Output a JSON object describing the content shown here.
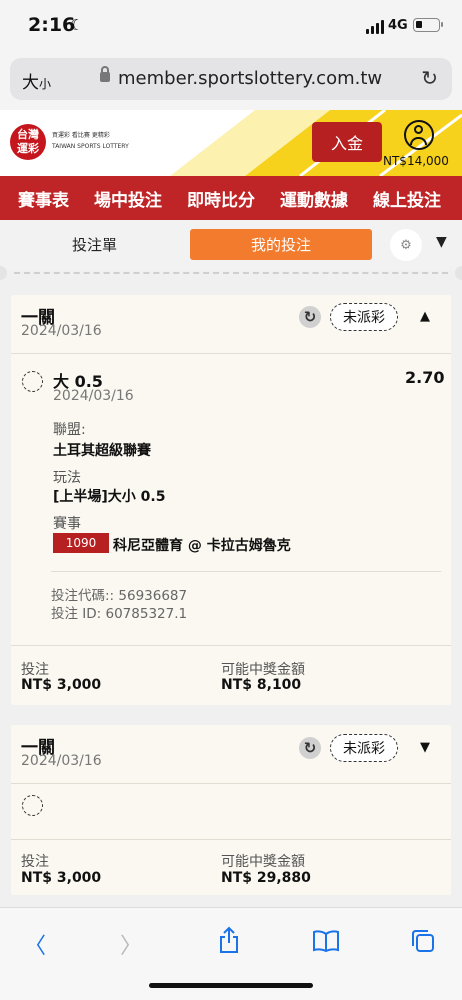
{
  "status_bar": {
    "time": "2:16",
    "network": "4G"
  },
  "browser": {
    "text_size_label": "大",
    "text_size_small": "小",
    "url": "member.sportslottery.com.tw"
  },
  "header": {
    "logo_line1": "台灣",
    "logo_line2": "運彩",
    "logo_tag1": "買運彩 看比賽 更精彩",
    "logo_tag2": "TAIWAN SPORTS LOTTERY",
    "deposit_label": "入金",
    "balance": "NT$14,000"
  },
  "nav": {
    "items": [
      "賽事表",
      "場中投注",
      "即時比分",
      "運動數據",
      "線上投注"
    ]
  },
  "bet_tabs": {
    "slip_label": "投注單",
    "my_bets_label": "我的投注"
  },
  "bets": [
    {
      "type": "一關",
      "date": "2024/03/16",
      "status": "未派彩",
      "selection": "大 0.5",
      "odds": "2.70",
      "selection_date": "2024/03/16",
      "league_label": "聯盟:",
      "league": "土耳其超級聯賽",
      "market_label": "玩法",
      "market": "[上半場]大小 0.5",
      "event_label": "賽事",
      "match_code": "1090",
      "match_name": "科尼亞體育 @ 卡拉古姆魯克",
      "bet_code": "投注代碼:: 56936687",
      "bet_id": "投注 ID: 60785327.1",
      "stake_label": "投注",
      "stake": "NT$ 3,000",
      "payout_label": "可能中獎金額",
      "payout": "NT$ 8,100"
    },
    {
      "type": "一關",
      "date": "2024/03/16",
      "status": "未派彩",
      "stake_label": "投注",
      "stake": "NT$ 3,000",
      "payout_label": "可能中獎金額",
      "payout": "NT$ 29,880"
    }
  ],
  "colors": {
    "brand_red": "#bf2426",
    "accent_orange": "#f27b2e",
    "browser_blue": "#1a73e8"
  }
}
